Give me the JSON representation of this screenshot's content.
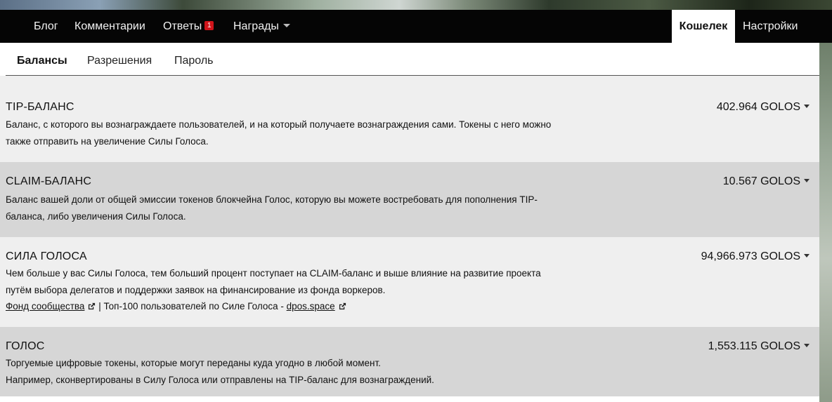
{
  "nav": {
    "blog": "Блог",
    "comments": "Комментарии",
    "replies": "Ответы",
    "replies_badge": "1",
    "rewards": "Награды",
    "wallet": "Кошелек",
    "settings": "Настройки"
  },
  "subtabs": {
    "balances": "Балансы",
    "permissions": "Разрешения",
    "password": "Пароль"
  },
  "balances": {
    "tip": {
      "title": "TIP-БАЛАНС",
      "amount": "402.964 GOLOS",
      "desc": "Баланс, с которого вы вознаграждаете пользователей, и на который получаете вознаграждения сами. Токены с него можно также отправить на увеличение Силы Голоса."
    },
    "claim": {
      "title": "CLAIM-БАЛАНС",
      "amount": "10.567 GOLOS",
      "desc": "Баланс вашей доли от общей эмиссии токенов блокчейна Голос, которую вы можете востребовать для пополнения TIP-баланса, либо увеличения Силы Голоса."
    },
    "power": {
      "title": "СИЛА ГОЛОСА",
      "amount": "94,966.973 GOLOS",
      "desc": "Чем больше у вас Силы Голоса, тем больший процент поступает на CLAIM-баланс и выше влияние на развитие проекта путём выбора делегатов и поддержки заявок на финансирование из фонда воркеров.",
      "link_fund": "Фонд сообщества",
      "separator": " | Топ-100 пользователей по Силе Голоса - ",
      "link_dpos": "dpos.space"
    },
    "golos": {
      "title": "ГОЛОС",
      "amount": "1,553.115 GOLOS",
      "desc_line1": "Торгуемые цифровые токены, которые могут переданы куда угодно в любой момент.",
      "desc_line2": "Например, сконвертированы в Силу Голоса или отправлены на TIP-баланс для вознаграждений."
    }
  }
}
